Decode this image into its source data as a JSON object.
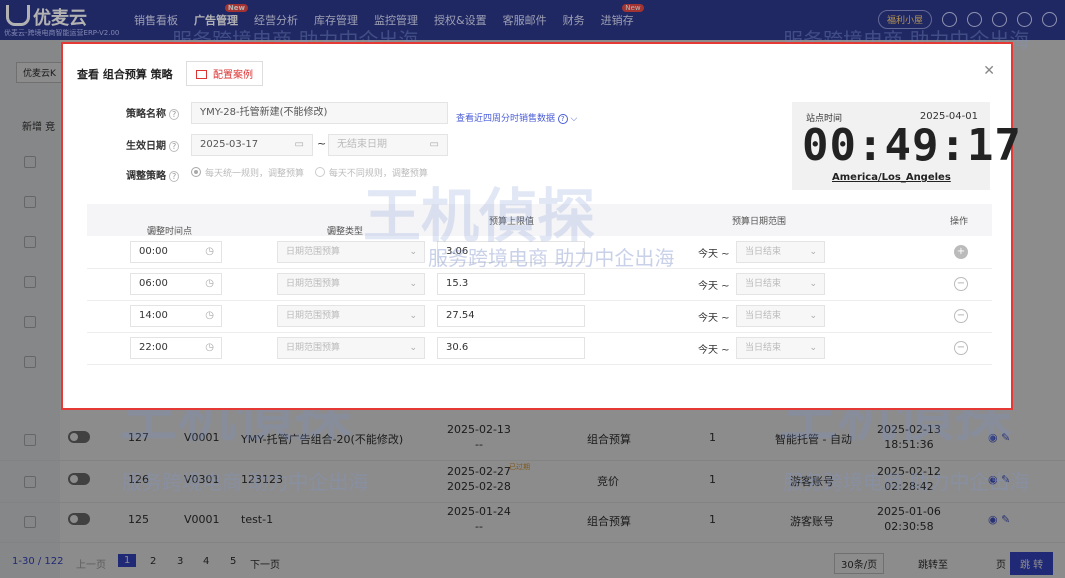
{
  "app": {
    "logo": "优麦云",
    "logo_sub": "优麦云-跨境电商智能运营ERP-V2.00"
  },
  "nav": {
    "items": [
      "销售看板",
      "广告管理",
      "经营分析",
      "库存管理",
      "监控管理",
      "授权&设置",
      "客服邮件",
      "财务",
      "进销存"
    ],
    "active_index": 1,
    "badges": {
      "1": "New",
      "8": "New"
    },
    "welfare": "福利小屋"
  },
  "background": {
    "shop_select": "优麦云K",
    "add_button": "新增 竞",
    "rows": [
      {
        "id": "127",
        "account": "V0001",
        "name": "YMY-托管广告组合-20(不能修改)",
        "date1": "2025-02-13",
        "date2": "--",
        "type": "组合预算",
        "count": "1",
        "mode": "智能托管 - 自动",
        "created1": "2025-02-13",
        "created2": "18:51:36"
      },
      {
        "id": "126",
        "account": "V0301",
        "name": "123123",
        "date1": "2025-02-27",
        "date2": "2025-02-28",
        "badge": "已过期",
        "type": "竞价",
        "count": "1",
        "mode": "游客账号",
        "created1": "2025-02-12",
        "created2": "02:28:42"
      },
      {
        "id": "125",
        "account": "V0001",
        "name": "test-1",
        "date1": "2025-01-24",
        "date2": "--",
        "type": "组合预算",
        "count": "1",
        "mode": "游客账号",
        "created1": "2025-01-06",
        "created2": "02:30:58"
      }
    ],
    "pager": {
      "range": "1-30 / 122",
      "prev": "上一页",
      "pages": [
        "1",
        "2",
        "3",
        "4",
        "5"
      ],
      "current": "1",
      "next": "下一页",
      "per_page": "30条/页",
      "jump_label": "跳转至",
      "page_unit": "页",
      "jump_button": "跳 转"
    }
  },
  "watermark": {
    "brand": "王机偵探",
    "slogan": "服务跨境电商 助力中企出海"
  },
  "modal": {
    "title": "查看 组合预算 策略",
    "case_button": "配置案例",
    "fields": {
      "name_label": "策略名称",
      "name_value": "YMY-28-托管新建(不能修改)",
      "date_label": "生效日期",
      "date_start": "2025-03-17",
      "date_end_placeholder": "无结束日期",
      "rule_label": "调整策略",
      "rule_option1": "每天统一规则，调整预算",
      "rule_option2": "每天不同规则，调整预算"
    },
    "sales_link": "查看近四周分时销售数据",
    "clock": {
      "label": "站点时间",
      "date": "2025-04-01",
      "time": "00:49:17",
      "zone": "America/Los_Angeles"
    },
    "table": {
      "headers": [
        "调整时间点",
        "调整类型",
        "预算上限值",
        "预算日期范围",
        "操作"
      ],
      "rows": [
        {
          "time": "00:00",
          "type": "日期范围预算",
          "value": "3.06",
          "from": "今天",
          "to": "当日结束"
        },
        {
          "time": "06:00",
          "type": "日期范围预算",
          "value": "15.3",
          "from": "今天",
          "to": "当日结束"
        },
        {
          "time": "14:00",
          "type": "日期范围预算",
          "value": "27.54",
          "from": "今天",
          "to": "当日结束"
        },
        {
          "time": "22:00",
          "type": "日期范围预算",
          "value": "30.6",
          "from": "今天",
          "to": "当日结束"
        }
      ]
    }
  }
}
